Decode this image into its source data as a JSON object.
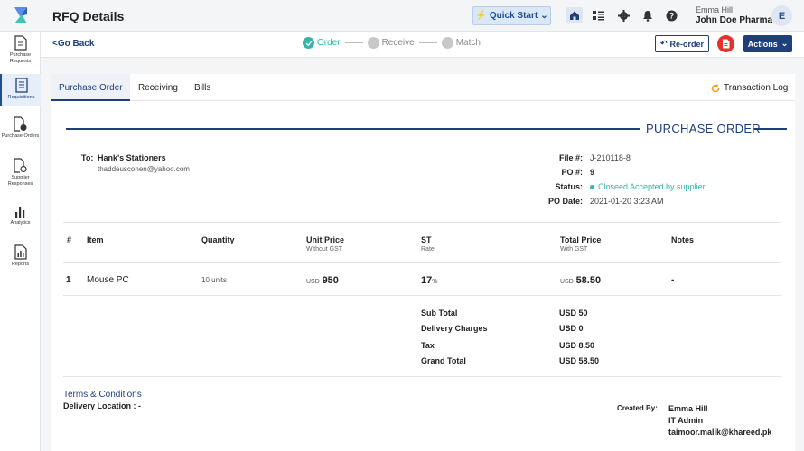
{
  "header": {
    "title": "RFQ Details",
    "quick_start": "Quick Start",
    "user_name": "Emma Hill",
    "user_org": "John Doe Pharma",
    "avatar_initial": "E"
  },
  "sidebar": {
    "items": [
      {
        "label": "Purchase Requests",
        "icon": "document-icon"
      },
      {
        "label": "Requisitions",
        "icon": "list-document-icon",
        "active": true
      },
      {
        "label": "Purchase Orders",
        "icon": "order-check-icon"
      },
      {
        "label": "Supplier Responses",
        "icon": "response-document-icon"
      },
      {
        "label": "Analytics",
        "icon": "bar-chart-icon"
      },
      {
        "label": "Reports",
        "icon": "report-chart-icon"
      }
    ]
  },
  "subbar": {
    "go_back": "<Go Back",
    "steps": [
      "Order",
      "Receive",
      "Match"
    ],
    "reorder": "Re-order",
    "actions": "Actions"
  },
  "tabs": {
    "items": [
      "Purchase Order",
      "Receiving",
      "Bills"
    ],
    "transaction_log": "Transaction Log"
  },
  "po": {
    "heading": "PURCHASE ORDER",
    "to_label": "To:",
    "to_name": "Hank's Stationers",
    "to_email": "thaddeuscohen@yahoo.com",
    "file_label": "File #:",
    "file_value": "J-210118-8",
    "po_label": "PO #:",
    "po_value": "9",
    "status_label": "Status:",
    "status_value": "Closeed Accepted by supplier",
    "date_label": "PO Date:",
    "date_value": "2021-01-20 3:23 AM"
  },
  "table": {
    "headers": {
      "num": "#",
      "item": "Item",
      "quantity": "Quantity",
      "unit_price": "Unit Price",
      "unit_price_sub": "Without GST",
      "st": "ST",
      "st_sub": "Rate",
      "total_price": "Total Price",
      "total_price_sub": "With GST",
      "notes": "Notes"
    },
    "rows": [
      {
        "num": "1",
        "item": "Mouse PC",
        "quantity": "10 units",
        "unit_currency": "USD",
        "unit_price": "950",
        "st": "17",
        "st_unit": "%",
        "total_currency": "USD",
        "total_price": "58.50",
        "notes": "-"
      }
    ]
  },
  "totals": {
    "sub_total_label": "Sub Total",
    "sub_total": "USD 50",
    "delivery_label": "Delivery Charges",
    "delivery": "USD 0",
    "tax_label": "Tax",
    "tax": "USD 8.50",
    "grand_label": "Grand Total",
    "grand": "USD 58.50"
  },
  "footer": {
    "terms": "Terms & Conditions",
    "delivery_location": "Delivery Location : -",
    "created_by_label": "Created By:",
    "created_name": "Emma Hill",
    "created_role": "IT Admin",
    "created_email": "taimoor.malik@khareed.pk"
  },
  "colors": {
    "primary": "#1f3f7a",
    "accent": "#34b6a9",
    "pdf_red": "#e2332b"
  }
}
